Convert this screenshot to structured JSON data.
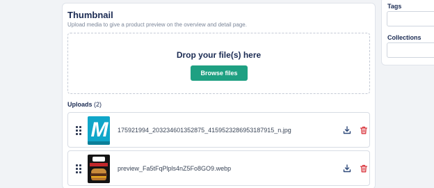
{
  "thumbnail": {
    "title": "Thumbnail",
    "subtitle": "Upload media to give a product preview on the overview and detail page.",
    "dropzone": {
      "prompt": "Drop your file(s) here",
      "browse_label": "Browse files"
    },
    "uploads": {
      "heading": "Uploads",
      "count": "(2)",
      "items": [
        {
          "file_name": "175921994_203234601352875_4159523286953187915_n.jpg",
          "thumb_icon": "m-logo-image",
          "thumb_color": "#10a6c9"
        },
        {
          "file_name": "preview_Fa5tFqPlpls4nZ5Fo8GO9.webp",
          "thumb_icon": "burger-ad-image",
          "thumb_color": "#141414"
        }
      ]
    }
  },
  "sidebar": {
    "tags_label": "Tags",
    "collections_label": "Collections"
  },
  "colors": {
    "accent": "#1ea082",
    "delete": "#d9363e",
    "download": "#2f4a7a",
    "heading": "#1a2a52"
  }
}
